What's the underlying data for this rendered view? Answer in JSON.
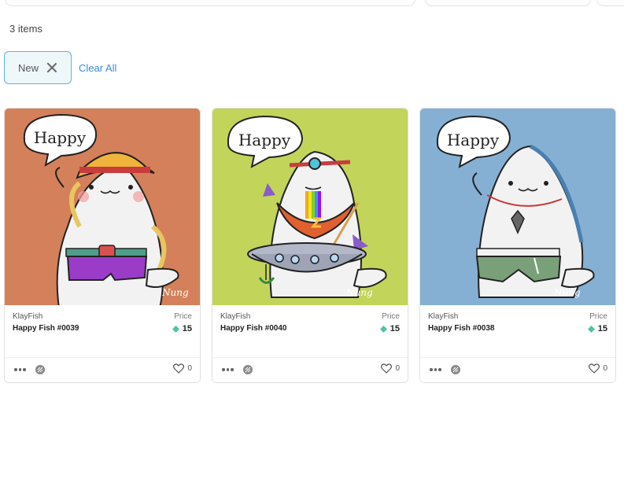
{
  "results": {
    "count_label": "3 items"
  },
  "filters": {
    "active": [
      {
        "label": "New"
      }
    ],
    "clear_all_label": "Clear All"
  },
  "colors": {
    "accent": "#3a8bd8",
    "chip_border": "#5fb6d6",
    "klay_token": "#4ec3a6"
  },
  "cards": [
    {
      "collection": "KlayFish",
      "name": "Happy Fish #0039",
      "price_label": "Price",
      "price": "15",
      "likes": "0",
      "art": {
        "background": "#d4805a",
        "speech": "Happy",
        "signature": "Nung",
        "accessory": "yellow-hat-purple-shorts"
      }
    },
    {
      "collection": "KlayFish",
      "name": "Happy Fish #0040",
      "price_label": "Price",
      "price": "15",
      "likes": "0",
      "art": {
        "background": "#c2d45a",
        "speech": "Happy",
        "signature": "Nung",
        "accessory": "ufo-rainbow"
      }
    },
    {
      "collection": "KlayFish",
      "name": "Happy Fish #0038",
      "price_label": "Price",
      "price": "15",
      "likes": "0",
      "art": {
        "background": "#85b0d3",
        "speech": "Happy",
        "signature": "Nung",
        "accessory": "necklace-green-shorts"
      }
    }
  ]
}
